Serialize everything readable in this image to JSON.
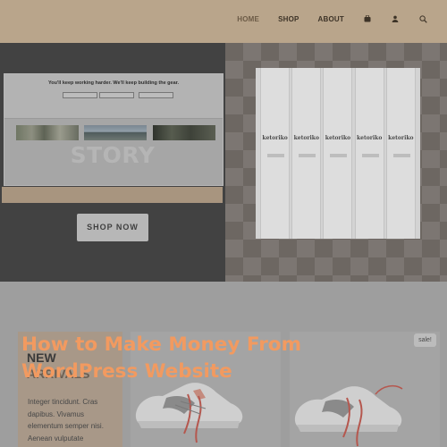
{
  "nav": {
    "items": [
      "HOME",
      "SHOP",
      "ABOUT"
    ],
    "icons": [
      "bag-icon",
      "user-icon",
      "search-icon"
    ]
  },
  "hero": {
    "popup_text": "You'll keep working harder. We'll keep building the gear.",
    "story_text": "STORY",
    "cta_label": "SHOP NOW",
    "shelf_brand": "ketoriko"
  },
  "promo": {
    "title": "NEW",
    "subtitle": "ARRIVALS",
    "body": "Integer tincidunt. Cras dapibus. Vivamus elementum semper nisi. Aenean vulputate"
  },
  "products": {
    "sale_badge": "sale!"
  },
  "overlay": {
    "title": "How to Make Money From WordPress Website"
  },
  "colors": {
    "header_bg": "#b9a58b",
    "hero_dark": "#424242",
    "promo_bg": "#a89888",
    "overlay_text": "#f29a60"
  }
}
